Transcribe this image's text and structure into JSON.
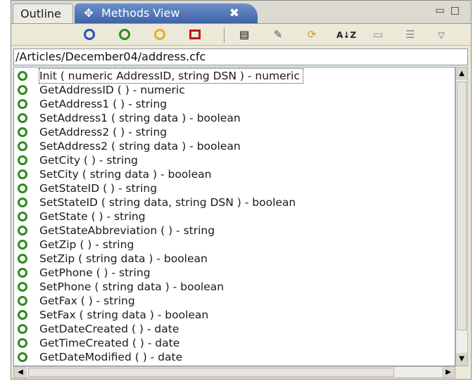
{
  "tabs": {
    "outline_label": "Outline",
    "active_label": "Methods View",
    "close_glyph": "✖",
    "active_icon": "methods-view-icon"
  },
  "window_controls": {
    "minimize": "▭",
    "maximize": "□"
  },
  "toolbar": {
    "buttons": [
      {
        "icon": "public-filter-icon",
        "color": "#3050c0"
      },
      {
        "icon": "private-filter-icon",
        "color": "#2f8a1f"
      },
      {
        "icon": "remote-filter-icon",
        "color": "#e0b020"
      },
      {
        "icon": "package-filter-icon",
        "color": "#c01818"
      },
      {
        "icon": "open-in-editor-icon"
      },
      {
        "icon": "insert-icon"
      },
      {
        "icon": "refresh-icon"
      },
      {
        "icon": "sort-icon"
      },
      {
        "icon": "layout-icon"
      },
      {
        "icon": "collapse-icon"
      },
      {
        "icon": "view-menu-icon"
      }
    ],
    "sort_label": "A↓Z"
  },
  "path": "/Articles/December04/address.cfc",
  "methods": [
    "Init ( numeric AddressID, string DSN ) - numeric",
    "GetAddressID ( ) - numeric",
    "GetAddress1 ( ) - string",
    "SetAddress1 ( string data ) - boolean",
    "GetAddress2 ( ) - string",
    "SetAddress2 ( string data ) - boolean",
    "GetCity ( ) - string",
    "SetCity ( string data ) - boolean",
    "GetStateID ( ) - string",
    "SetStateID ( string data, string DSN ) - boolean",
    "GetState ( ) - string",
    "GetStateAbbreviation ( ) - string",
    "GetZip ( ) - string",
    "SetZip ( string data ) - boolean",
    "GetPhone ( ) - string",
    "SetPhone ( string data ) - boolean",
    "GetFax ( ) - string",
    "SetFax ( string data ) - boolean",
    "GetDateCreated ( ) - date",
    "GetTimeCreated ( ) - date",
    "GetDateModified ( ) - date"
  ],
  "colors": {
    "method_icon": "#2f8a1f",
    "active_tab": "#4a6fb5"
  }
}
